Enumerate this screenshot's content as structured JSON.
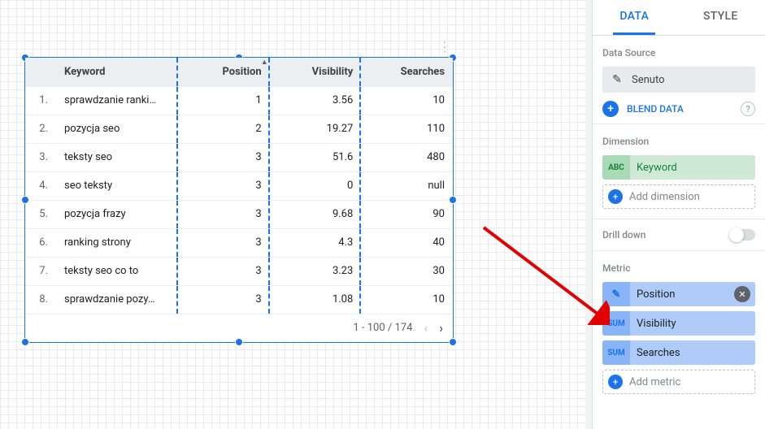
{
  "canvas": {
    "table": {
      "headers": [
        "",
        "Keyword",
        "Position",
        "Visibility",
        "Searches"
      ],
      "sort_col_index": 2,
      "rows": [
        {
          "n": "1.",
          "keyword": "sprawdzanie ranki…",
          "position": "1",
          "visibility": "3.56",
          "searches": "10"
        },
        {
          "n": "2.",
          "keyword": "pozycja seo",
          "position": "2",
          "visibility": "19.27",
          "searches": "110"
        },
        {
          "n": "3.",
          "keyword": "teksty seo",
          "position": "3",
          "visibility": "51.6",
          "searches": "480"
        },
        {
          "n": "4.",
          "keyword": "seo teksty",
          "position": "3",
          "visibility": "0",
          "searches": "null"
        },
        {
          "n": "5.",
          "keyword": "pozycja frazy",
          "position": "3",
          "visibility": "9.68",
          "searches": "90"
        },
        {
          "n": "6.",
          "keyword": "ranking strony",
          "position": "3",
          "visibility": "4.3",
          "searches": "40"
        },
        {
          "n": "7.",
          "keyword": "teksty seo co to",
          "position": "3",
          "visibility": "3.23",
          "searches": "30"
        },
        {
          "n": "8.",
          "keyword": "sprawdzanie pozy…",
          "position": "3",
          "visibility": "1.08",
          "searches": "10"
        }
      ],
      "pager": "1 - 100 / 174"
    }
  },
  "side": {
    "tabs": {
      "data": "DATA",
      "style": "STYLE"
    },
    "data_source": {
      "title": "Data Source",
      "value": "Senuto",
      "blend": "BLEND DATA"
    },
    "dimension": {
      "title": "Dimension",
      "badge": "ABC",
      "value": "Keyword",
      "add": "Add dimension"
    },
    "drill": {
      "label": "Drill down"
    },
    "metric": {
      "title": "Metric",
      "items": [
        {
          "badge_icon": "pencil",
          "label": "Position",
          "removable": true
        },
        {
          "badge": "SUM",
          "label": "Visibility"
        },
        {
          "badge": "SUM",
          "label": "Searches"
        }
      ],
      "add": "Add metric"
    }
  }
}
